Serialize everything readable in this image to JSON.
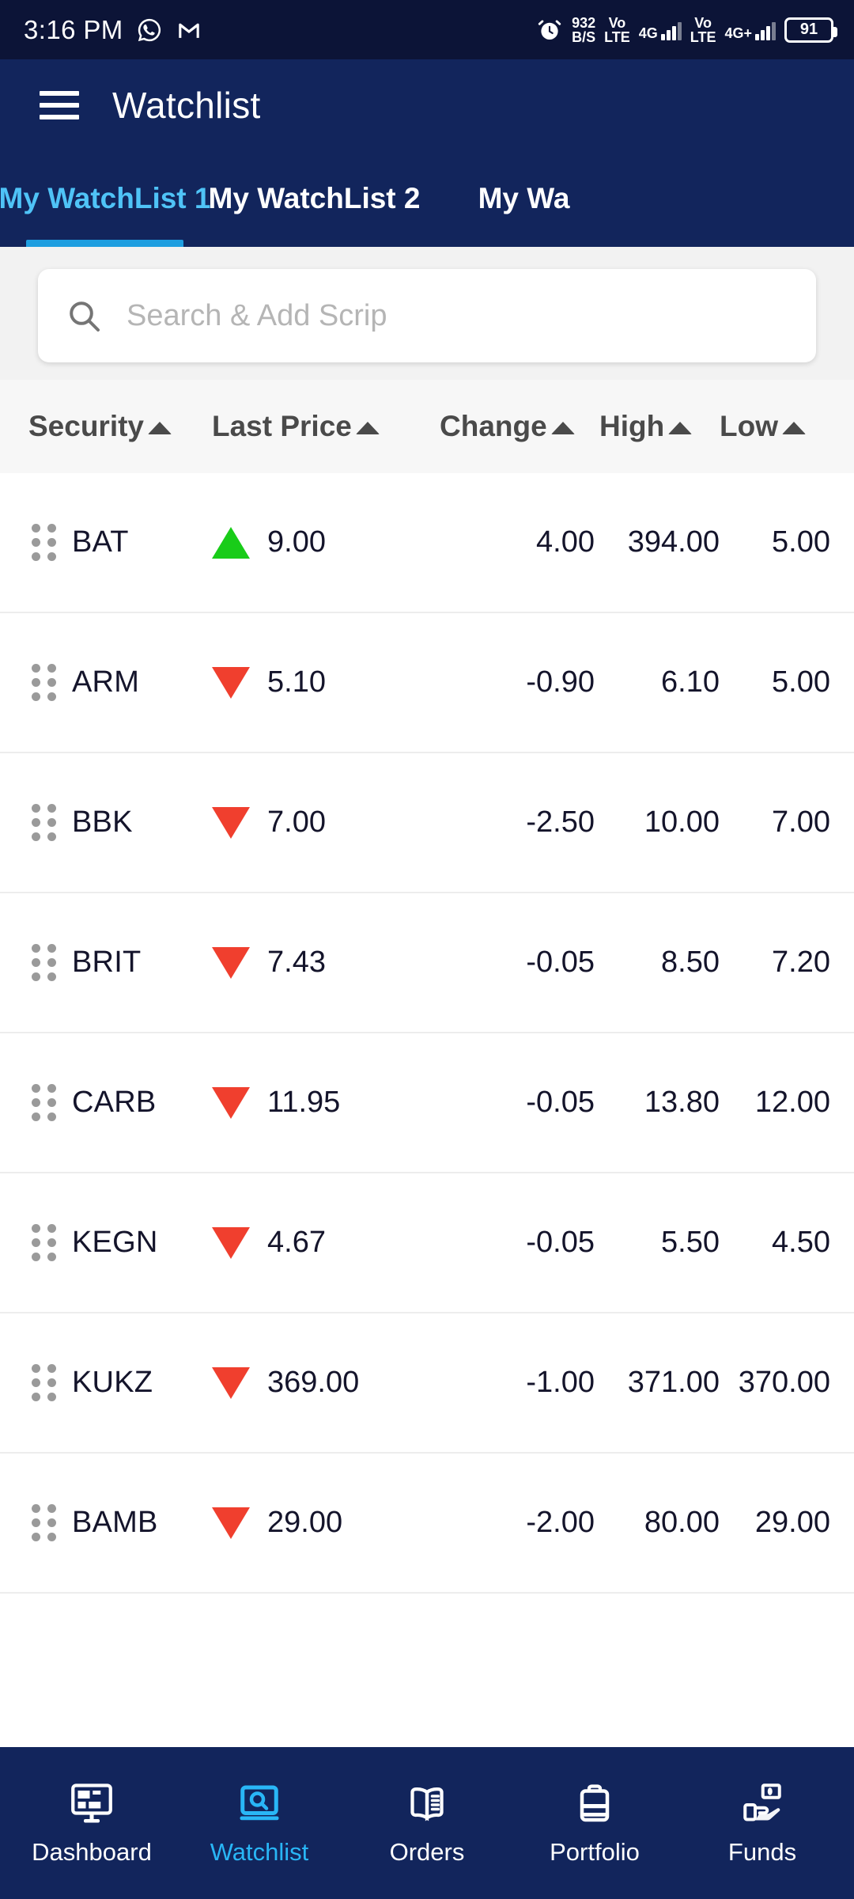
{
  "status_bar": {
    "time": "3:16 PM",
    "whatsapp_icon": "whatsapp-icon",
    "gmail_icon": "gmail-icon",
    "alarm_icon": "alarm-icon",
    "network_speed_value": "932",
    "network_speed_unit": "B/S",
    "sim1_volte": "Vo",
    "sim1_volte2": "LTE",
    "sim1_network": "4G",
    "sim2_volte": "Vo",
    "sim2_volte2": "LTE",
    "sim2_network": "4G+",
    "battery_level": "91"
  },
  "app_bar": {
    "menu_icon": "hamburger-menu-icon",
    "title": "Watchlist"
  },
  "tabs": {
    "items": [
      {
        "label": "My WatchList 1",
        "active": true
      },
      {
        "label": "My WatchList 2",
        "active": false
      },
      {
        "label": "My Wa",
        "active": false
      }
    ]
  },
  "search": {
    "icon": "search-icon",
    "placeholder": "Search & Add Scrip",
    "value": ""
  },
  "table": {
    "headers": [
      {
        "label": "Security",
        "sort": "asc"
      },
      {
        "label": "Last Price",
        "sort": "asc"
      },
      {
        "label": "Change",
        "sort": "asc"
      },
      {
        "label": "High",
        "sort": "asc"
      },
      {
        "label": "Low",
        "sort": "asc"
      }
    ],
    "rows": [
      {
        "security": "BAT",
        "direction": "up",
        "last_price": "9.00",
        "change": "4.00",
        "high": "394.00",
        "low": "5.00"
      },
      {
        "security": "ARM",
        "direction": "down",
        "last_price": "5.10",
        "change": "-0.90",
        "high": "6.10",
        "low": "5.00"
      },
      {
        "security": "BBK",
        "direction": "down",
        "last_price": "7.00",
        "change": "-2.50",
        "high": "10.00",
        "low": "7.00"
      },
      {
        "security": "BRIT",
        "direction": "down",
        "last_price": "7.43",
        "change": "-0.05",
        "high": "8.50",
        "low": "7.20"
      },
      {
        "security": "CARB",
        "direction": "down",
        "last_price": "11.95",
        "change": "-0.05",
        "high": "13.80",
        "low": "12.00"
      },
      {
        "security": "KEGN",
        "direction": "down",
        "last_price": "4.67",
        "change": "-0.05",
        "high": "5.50",
        "low": "4.50"
      },
      {
        "security": "KUKZ",
        "direction": "down",
        "last_price": "369.00",
        "change": "-1.00",
        "high": "371.00",
        "low": "370.00"
      },
      {
        "security": "BAMB",
        "direction": "down",
        "last_price": "29.00",
        "change": "-2.00",
        "high": "80.00",
        "low": "29.00"
      }
    ]
  },
  "bottom_nav": {
    "items": [
      {
        "label": "Dashboard",
        "icon": "dashboard-monitor-icon",
        "active": false
      },
      {
        "label": "Watchlist",
        "icon": "watchlist-screen-search-icon",
        "active": true
      },
      {
        "label": "Orders",
        "icon": "orders-book-icon",
        "active": false
      },
      {
        "label": "Portfolio",
        "icon": "portfolio-briefcase-icon",
        "active": false
      },
      {
        "label": "Funds",
        "icon": "funds-hand-money-icon",
        "active": false
      }
    ]
  },
  "colors": {
    "navy": "#12255c",
    "status_navy": "#0c1437",
    "accent_cyan": "#29b6f6",
    "tab_active": "#4fc3f7",
    "tab_indicator": "#1e9ee0",
    "up_green": "#19cc19",
    "down_red": "#f03f2e",
    "page_bg": "#f2f2f2",
    "header_bg": "#f7f7f7"
  }
}
